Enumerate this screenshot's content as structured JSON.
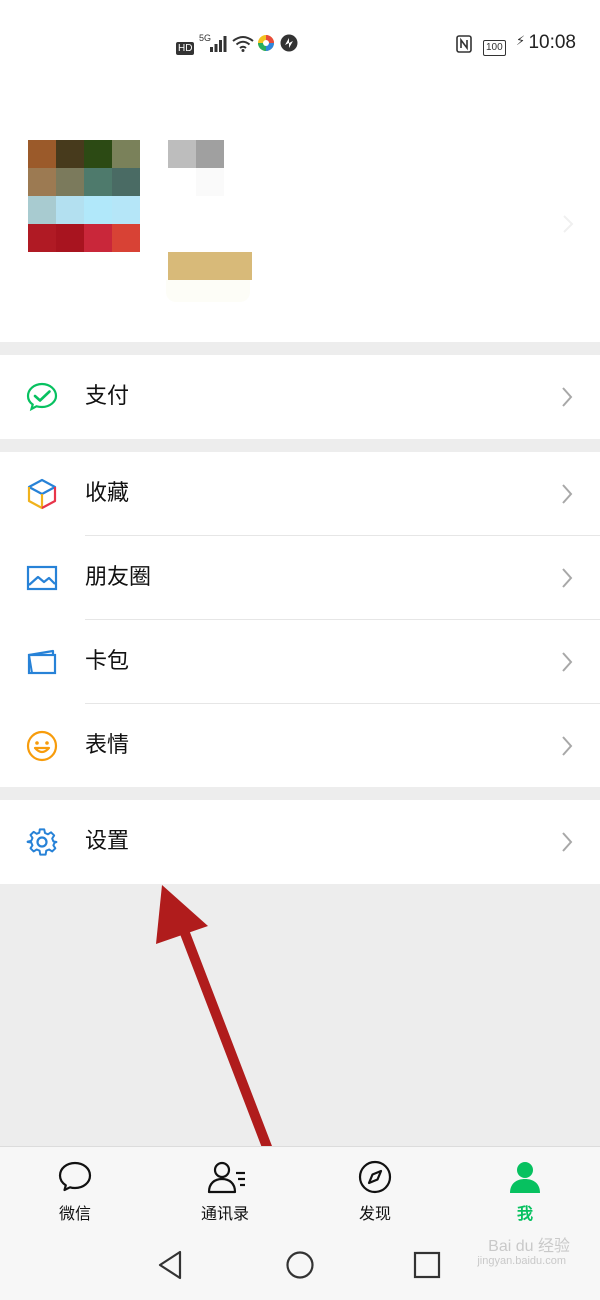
{
  "status_bar": {
    "hd": "HD",
    "network": "5G",
    "battery": "100",
    "time": "10:08"
  },
  "menu": {
    "pay": "支付",
    "favorites": "收藏",
    "moments": "朋友圈",
    "cards": "卡包",
    "stickers": "表情",
    "settings": "设置"
  },
  "tabs": [
    {
      "label": "微信",
      "icon": "chat-bubble-icon"
    },
    {
      "label": "通讯录",
      "icon": "contacts-icon"
    },
    {
      "label": "发现",
      "icon": "compass-icon"
    },
    {
      "label": "我",
      "icon": "person-icon",
      "active": true
    }
  ],
  "colors": {
    "accent": "#07c160",
    "pay_icon": "#07c160",
    "moments_icon": "#2782d7",
    "cards_icon": "#2782d7",
    "stickers_icon": "#f79c0c",
    "settings_icon": "#2782d7",
    "annotation_arrow": "#b01c1c",
    "background": "#ededed"
  },
  "watermark": {
    "text": "Bai du 经验",
    "sub": "jingyan.baidu.com"
  }
}
